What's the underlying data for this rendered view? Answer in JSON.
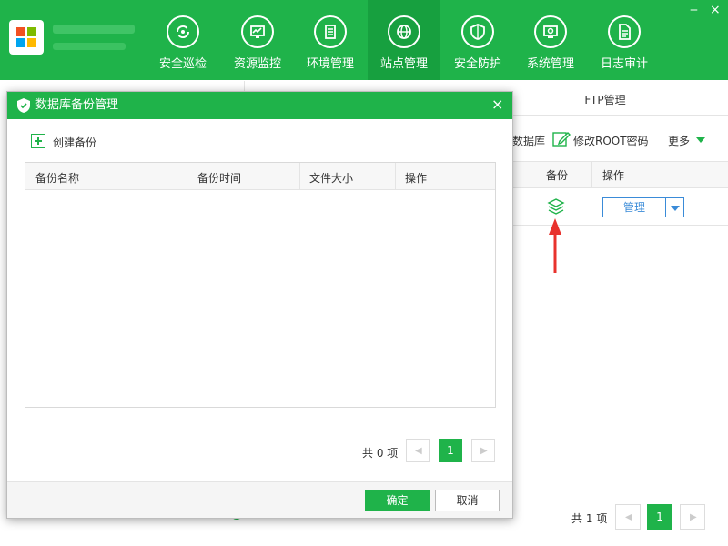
{
  "window": {
    "minimize": "‒",
    "close": "×"
  },
  "nav": {
    "items": [
      {
        "label": "安全巡检",
        "icon": "refresh-shield-icon"
      },
      {
        "label": "资源监控",
        "icon": "monitor-chart-icon"
      },
      {
        "label": "环境管理",
        "icon": "server-icon"
      },
      {
        "label": "站点管理",
        "icon": "globe-icon",
        "active": true
      },
      {
        "label": "安全防护",
        "icon": "shield-icon"
      },
      {
        "label": "系统管理",
        "icon": "settings-monitor-icon"
      },
      {
        "label": "日志审计",
        "icon": "document-icon"
      }
    ]
  },
  "background": {
    "ftp_tab": "FTP管理",
    "db_label": "数据库",
    "root_password": "修改ROOT密码",
    "more": "更多",
    "table_headers": {
      "backup": "备份",
      "operation": "操作"
    },
    "manage_button": "管理",
    "total": "共 1 项",
    "page": "1"
  },
  "dialog": {
    "title": "数据库备份管理",
    "close": "×",
    "create_backup": "创建备份",
    "columns": [
      "备份名称",
      "备份时间",
      "文件大小",
      "操作"
    ],
    "total": "共 0 项",
    "page": "1",
    "ok": "确定",
    "cancel": "取消"
  },
  "colors": {
    "brand_green": "#1fb34a",
    "active_green": "#17a03f",
    "link_blue": "#3a8bd8",
    "arrow_red": "#e8322d"
  }
}
